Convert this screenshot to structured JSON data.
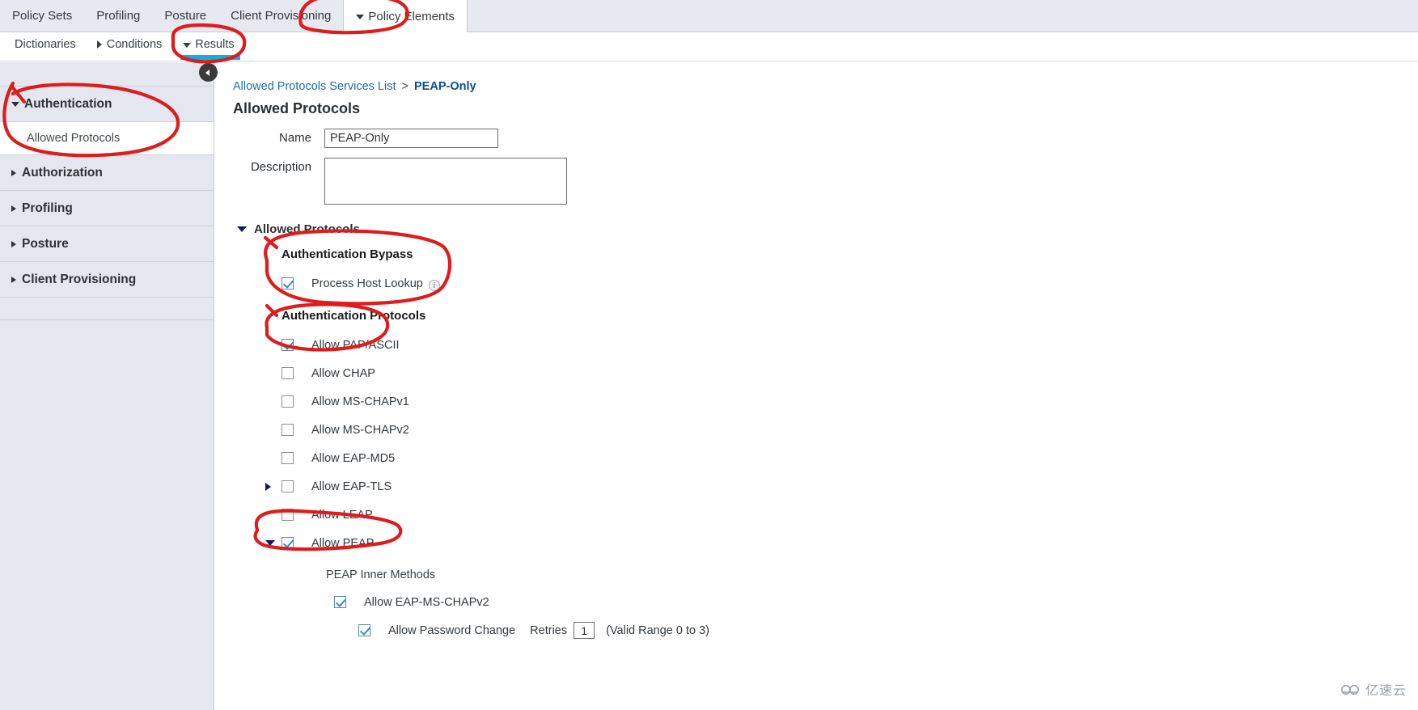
{
  "top_tabs": [
    {
      "label": "Policy Sets",
      "active": false,
      "caret": "none"
    },
    {
      "label": "Profiling",
      "active": false,
      "caret": "none"
    },
    {
      "label": "Posture",
      "active": false,
      "caret": "none"
    },
    {
      "label": "Client Provisioning",
      "active": false,
      "caret": "none"
    },
    {
      "label": "Policy Elements",
      "active": true,
      "caret": "down"
    }
  ],
  "sub_tabs": [
    {
      "label": "Dictionaries",
      "active": false,
      "caret": "none"
    },
    {
      "label": "Conditions",
      "active": false,
      "caret": "right"
    },
    {
      "label": "Results",
      "active": true,
      "caret": "down"
    }
  ],
  "sidebar": {
    "groups": [
      {
        "label": "Authentication",
        "expanded": true,
        "children": [
          {
            "label": "Allowed Protocols",
            "selected": true
          }
        ]
      },
      {
        "label": "Authorization",
        "expanded": false,
        "children": []
      },
      {
        "label": "Profiling",
        "expanded": false,
        "children": []
      },
      {
        "label": "Posture",
        "expanded": false,
        "children": []
      },
      {
        "label": "Client Provisioning",
        "expanded": false,
        "children": []
      }
    ]
  },
  "breadcrumb": {
    "parent": "Allowed Protocols Services List",
    "separator": ">",
    "current": "PEAP-Only"
  },
  "page_title": "Allowed Protocols",
  "form": {
    "name_label": "Name",
    "name_value": "PEAP-Only",
    "description_label": "Description",
    "description_value": ""
  },
  "allowed_protocols_section": {
    "header": "Allowed Protocols",
    "auth_bypass_title": "Authentication Bypass",
    "process_host_lookup": {
      "label": "Process Host Lookup",
      "checked": true,
      "info": "i"
    },
    "auth_protocols_title": "Authentication Protocols",
    "protocols": [
      {
        "label": "Allow PAP/ASCII",
        "checked": true,
        "expander": "none"
      },
      {
        "label": "Allow CHAP",
        "checked": false,
        "expander": "none"
      },
      {
        "label": "Allow MS-CHAPv1",
        "checked": false,
        "expander": "none"
      },
      {
        "label": "Allow MS-CHAPv2",
        "checked": false,
        "expander": "none"
      },
      {
        "label": "Allow EAP-MD5",
        "checked": false,
        "expander": "none"
      },
      {
        "label": "Allow EAP-TLS",
        "checked": false,
        "expander": "right"
      },
      {
        "label": "Allow LEAP",
        "checked": false,
        "expander": "none"
      },
      {
        "label": "Allow PEAP",
        "checked": true,
        "expander": "down"
      }
    ],
    "peap_inner_methods_title": "PEAP Inner Methods",
    "peap_inner": {
      "label": "Allow EAP-MS-CHAPv2",
      "checked": true
    },
    "password_change": {
      "label": "Allow Password Change",
      "checked": true,
      "retries_label": "Retries",
      "retries_value": "1",
      "range_note": "(Valid Range 0 to 3)"
    }
  },
  "collapse_button": {
    "icon": "chevron-left-icon"
  },
  "watermark": {
    "text": "亿速云"
  },
  "colors": {
    "accent_blue": "#0fb0df",
    "link_blue": "#1c6ea4",
    "sidebar_bg": "#e4e7ef",
    "tabbar_bg": "#e7e9f0",
    "annotation_red": "#e01b1b",
    "triangle_navy": "#141a5c"
  }
}
